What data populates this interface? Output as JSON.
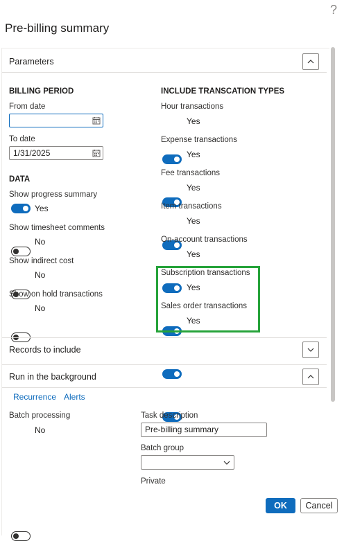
{
  "help_glyph": "?",
  "dialog": {
    "title": "Pre-billing summary"
  },
  "parameters": {
    "header": "Parameters",
    "billing_period": {
      "heading": "BILLING PERIOD",
      "from_label": "From date",
      "from_value": "",
      "to_label": "To date",
      "to_value": "1/31/2025"
    },
    "data_group": {
      "heading": "DATA",
      "items": [
        {
          "label": "Show progress summary",
          "value": "Yes",
          "on": true
        },
        {
          "label": "Show timesheet comments",
          "value": "No",
          "on": false
        },
        {
          "label": "Show indirect cost",
          "value": "No",
          "on": false
        },
        {
          "label": "Show on hold transactions",
          "value": "No",
          "on": false
        }
      ]
    },
    "transaction_types": {
      "heading": "INCLUDE TRANSCATION TYPES",
      "items": [
        {
          "label": "Hour transactions",
          "value": "Yes",
          "on": true
        },
        {
          "label": "Expense transactions",
          "value": "Yes",
          "on": true
        },
        {
          "label": "Fee transactions",
          "value": "Yes",
          "on": true
        },
        {
          "label": "Item transactions",
          "value": "Yes",
          "on": true
        },
        {
          "label": "On-account transactions",
          "value": "Yes",
          "on": true
        },
        {
          "label": "Subscription transactions",
          "value": "Yes",
          "on": true
        },
        {
          "label": "Sales order transactions",
          "value": "Yes",
          "on": true
        }
      ]
    }
  },
  "records": {
    "header": "Records to include"
  },
  "background": {
    "header": "Run in the background",
    "links": [
      "Recurrence",
      "Alerts"
    ],
    "batch_label": "Batch processing",
    "batch_value": "No",
    "task_label": "Task description",
    "task_value": "Pre-billing summary",
    "group_label": "Batch group",
    "group_value": "",
    "private_label": "Private"
  },
  "footer": {
    "ok": "OK",
    "cancel": "Cancel"
  },
  "colors": {
    "accent": "#0f6cbd",
    "highlight": "#26a33a"
  }
}
